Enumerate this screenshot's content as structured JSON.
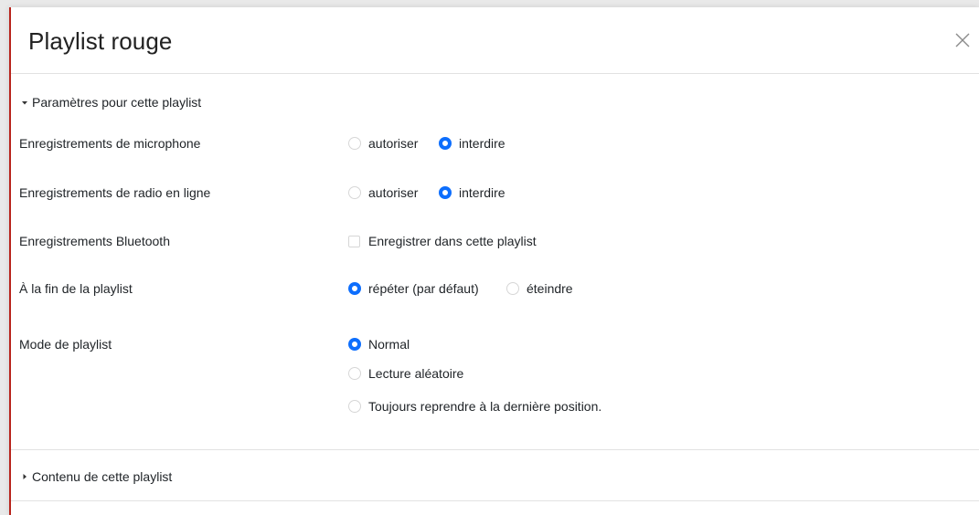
{
  "dialog": {
    "title": "Playlist rouge",
    "close_icon": "close-icon"
  },
  "settings_section": {
    "label": "Paramètres pour cette playlist",
    "expanded": true,
    "rows": {
      "microphone": {
        "label": "Enregistrements de microphone",
        "options": [
          "autoriser",
          "interdire"
        ],
        "selected": "interdire"
      },
      "radio": {
        "label": "Enregistrements de radio en ligne",
        "options": [
          "autoriser",
          "interdire"
        ],
        "selected": "interdire"
      },
      "bluetooth": {
        "label": "Enregistrements Bluetooth",
        "checkbox_label": "Enregistrer dans cette playlist",
        "checked": false
      },
      "end_of_playlist": {
        "label": "À la fin de la playlist",
        "options": [
          "répéter (par défaut)",
          "éteindre"
        ],
        "selected": "répéter (par défaut)"
      },
      "mode": {
        "label": "Mode de playlist",
        "options": [
          "Normal",
          "Lecture aléatoire",
          "Toujours reprendre à la dernière position."
        ],
        "selected": "Normal"
      }
    }
  },
  "content_section": {
    "label": "Contenu de cette playlist",
    "expanded": false
  },
  "colors": {
    "accent": "#0d6efd",
    "border_accent": "#b8241c"
  }
}
